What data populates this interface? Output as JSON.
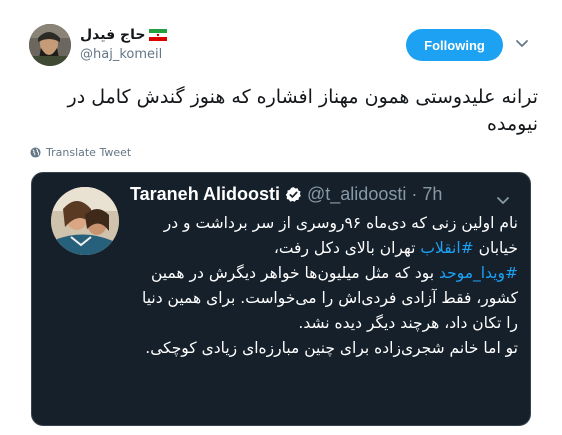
{
  "author": {
    "display_name": "حاج فیدل",
    "handle": "@haj_komeil",
    "avatar_icon": "profile-photo-icon",
    "flag_icon": "iran-flag-icon"
  },
  "follow_button": {
    "label": "Following",
    "color": "#1da1f2"
  },
  "tweet": {
    "text": "ترانه علیدوستی همون مهناز افشاره که هنوز گندش کامل در نیومده"
  },
  "translate": {
    "label": "Translate Tweet",
    "icon": "globe-icon"
  },
  "quoted_tweet": {
    "display_name": "Taraneh Alidoosti",
    "handle": "@t_alidoosti",
    "time": "· 7h",
    "verified_icon": "verified-badge-icon",
    "background": "#15202b",
    "hashtag_color": "#1da1f2",
    "text_before_hashtag1": "نام اولین زنی که دی‌ماه ۹۶روسری از سر برداشت و در خیابان ",
    "hashtag1": "#انقلاب",
    "text_after_hashtag1": " تهران بالای دکل رفت،",
    "hashtag2": "#ویدا_موحد",
    "text_after_hashtag2": " بود که مثل میلیون‌ها خواهر دیگرش در همین کشور، فقط آزادی فردی‌اش را می‌خواست. برای همین دنیا را تکان داد، هرچند دیگر دیده نشد.\nتو اما خانم شجری‌زاده برای چنین مبارزه‌ای زیادی کوچکی."
  }
}
